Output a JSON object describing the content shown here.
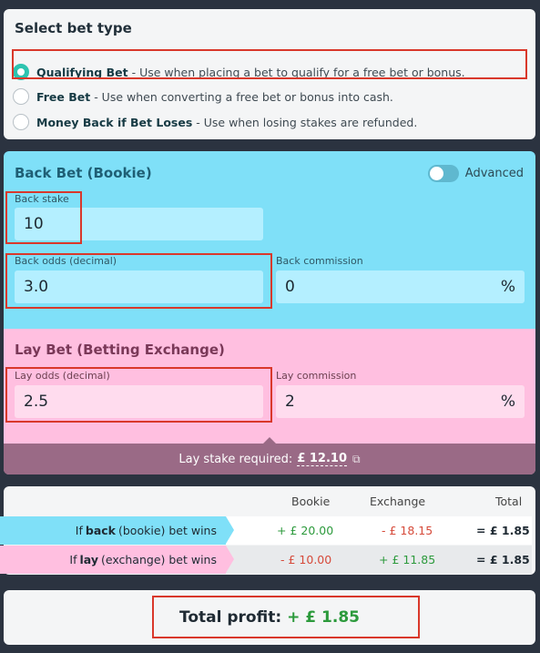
{
  "bet_type": {
    "title": "Select bet type",
    "options": [
      {
        "name": "Qualifying Bet",
        "desc": " - Use when placing a bet to qualify for a free bet or bonus.",
        "selected": true
      },
      {
        "name": "Free Bet",
        "desc": " - Use when converting a free bet or bonus into cash.",
        "selected": false
      },
      {
        "name": "Money Back if Bet Loses",
        "desc": " - Use when losing stakes are refunded.",
        "selected": false
      }
    ]
  },
  "back_bet": {
    "title": "Back Bet (Bookie)",
    "advanced_label": "Advanced",
    "advanced_on": false,
    "stake_label": "Back stake",
    "stake_value": "10",
    "odds_label": "Back odds (decimal)",
    "odds_value": "3.0",
    "commission_label": "Back commission",
    "commission_value": "0",
    "percent": "%"
  },
  "lay_bet": {
    "title": "Lay Bet (Betting Exchange)",
    "odds_label": "Lay odds (decimal)",
    "odds_value": "2.5",
    "commission_label": "Lay commission",
    "commission_value": "2",
    "percent": "%",
    "stake_required_label": "Lay stake required:",
    "stake_required_value": "£ 12.10"
  },
  "results": {
    "headers": [
      "Bookie",
      "Exchange",
      "Total"
    ],
    "rows": [
      {
        "pre": "If ",
        "bold": "back",
        "post": " (bookie) bet wins",
        "bookie": "+ £ 20.00",
        "exchange": "- £ 18.15",
        "total": "= £ 1.85"
      },
      {
        "pre": "If ",
        "bold": "lay",
        "post": " (exchange) bet wins",
        "bookie": "- £ 10.00",
        "exchange": "+ £ 11.85",
        "total": "= £ 1.85"
      }
    ]
  },
  "total_profit": {
    "label": "Total profit:",
    "value": "+ £ 1.85"
  },
  "colors": {
    "accent": "#2dc4b0",
    "back_bg": "#7fe0f8",
    "lay_bg": "#ffbfe0",
    "positive": "#2c9a3c",
    "negative": "#d64a3a",
    "highlight": "#d9382b"
  }
}
